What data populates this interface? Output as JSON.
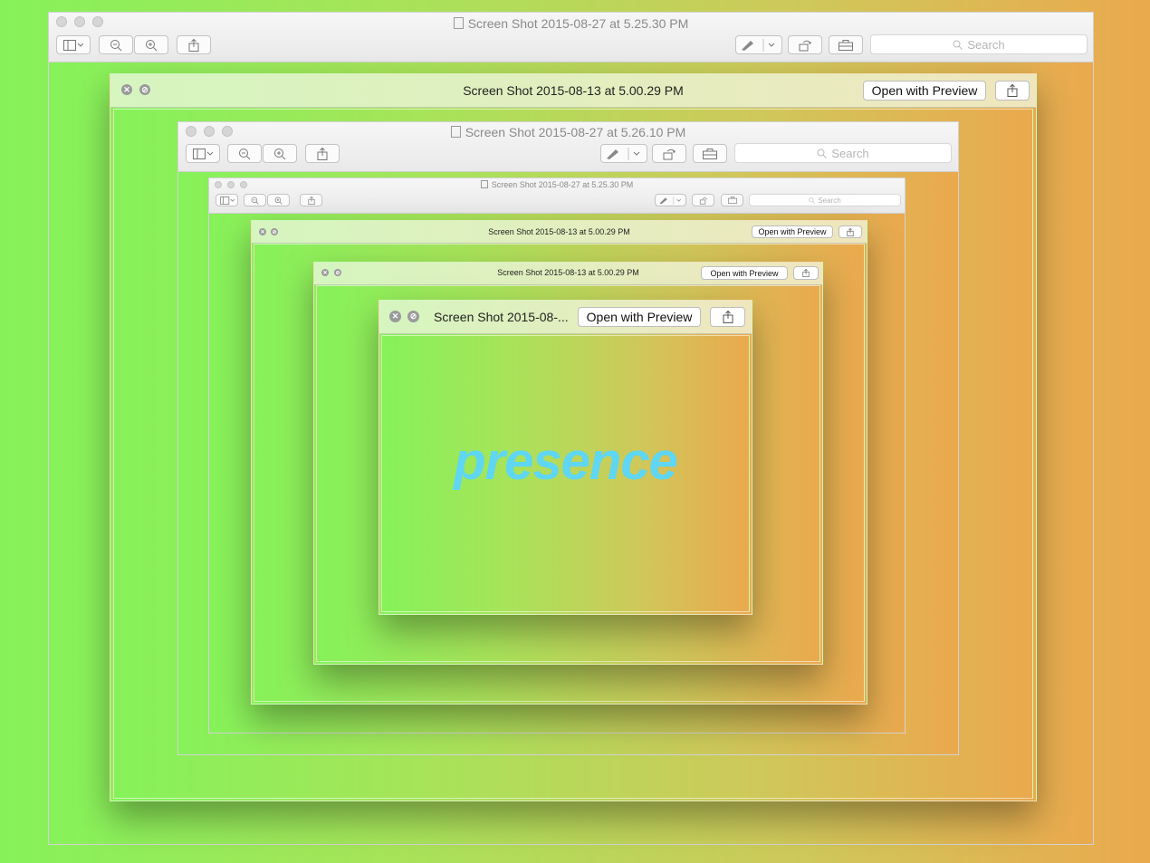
{
  "windows": {
    "w1": {
      "title": "Screen Shot 2015-08-27 at 5.25.30 PM",
      "search_placeholder": "Search"
    },
    "w2": {
      "title": "Screen Shot 2015-08-13 at 5.00.29 PM",
      "open_with_label": "Open with Preview"
    },
    "w3": {
      "title": "Screen Shot 2015-08-27 at 5.26.10 PM",
      "search_placeholder": "Search"
    },
    "w4": {
      "title": "Screen Shot 2015-08-27 at 5.25.30 PM",
      "search_placeholder": "Search"
    },
    "w5": {
      "title": "Screen Shot 2015-08-13 at 5.00.29 PM",
      "open_with_label": "Open with Preview"
    },
    "w6": {
      "title": "Screen Shot 2015-08-13 at 5.00.29 PM",
      "open_with_label": "Open with Preview"
    },
    "w7": {
      "title": "Screen Shot 2015-08-...",
      "open_with_label": "Open with Preview"
    }
  },
  "content_word": "presence",
  "colors": {
    "gradient_start": "#86f25a",
    "gradient_end": "#eaa94e",
    "word": "#5fd6f2"
  }
}
